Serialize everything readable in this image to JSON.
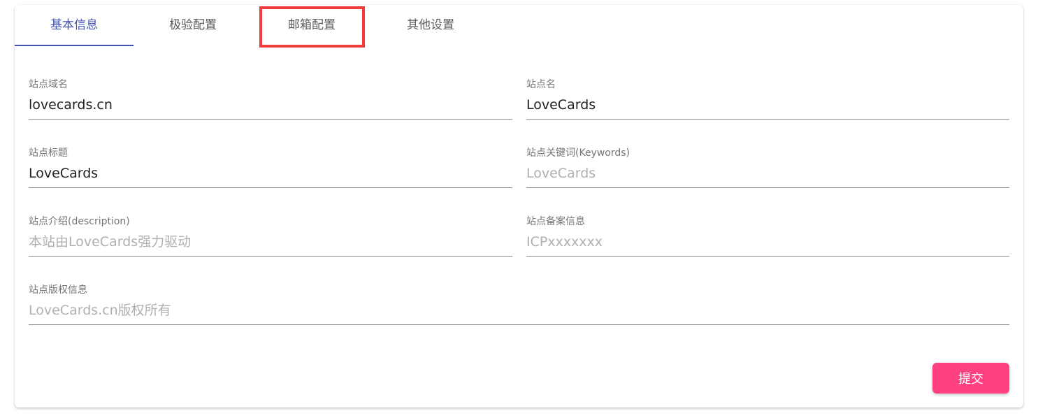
{
  "tabs": [
    {
      "label": "基本信息",
      "active": true
    },
    {
      "label": "极验配置",
      "active": false
    },
    {
      "label": "邮箱配置",
      "active": false
    },
    {
      "label": "其他设置",
      "active": false
    }
  ],
  "form": {
    "site_domain": {
      "label": "站点域名",
      "value": "lovecards.cn",
      "placeholder": ""
    },
    "site_name": {
      "label": "站点名",
      "value": "LoveCards",
      "placeholder": ""
    },
    "site_title": {
      "label": "站点标题",
      "value": "LoveCards",
      "placeholder": ""
    },
    "site_keywords": {
      "label": "站点关键词(Keywords)",
      "value": "",
      "placeholder": "LoveCards"
    },
    "site_description": {
      "label": "站点介绍(description)",
      "value": "",
      "placeholder": "本站由LoveCards强力驱动"
    },
    "site_icp": {
      "label": "站点备案信息",
      "value": "",
      "placeholder": "ICPxxxxxxx"
    },
    "site_copyright": {
      "label": "站点版权信息",
      "value": "",
      "placeholder": "LoveCards.cn版权所有"
    }
  },
  "submit_label": "提交",
  "colors": {
    "accent": "#3f51b5",
    "submit": "#ff4081",
    "highlight": "#f23c3c"
  }
}
